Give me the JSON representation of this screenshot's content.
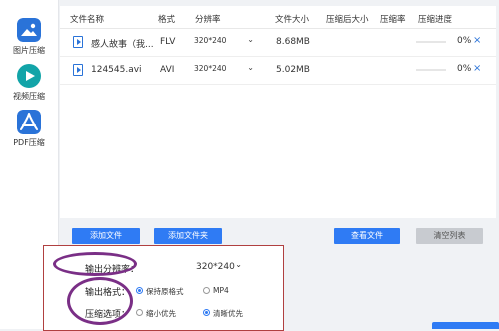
{
  "sidebar": {
    "items": [
      {
        "label": "图片压缩",
        "icon": "image-icon"
      },
      {
        "label": "视频压缩",
        "icon": "play-icon"
      },
      {
        "label": "PDF压缩",
        "icon": "pdf-icon"
      }
    ]
  },
  "table": {
    "headers": [
      "文件名称",
      "格式",
      "分辨率",
      "文件大小",
      "压缩后大小",
      "压缩率",
      "压缩进度"
    ],
    "rows": [
      {
        "name": "感人故事（我...",
        "format": "FLV",
        "resolution": "320*240",
        "size": "8.68MB",
        "compressed_size": "",
        "ratio": "",
        "progress": 0,
        "progress_text": "0%"
      },
      {
        "name": "124545.avi",
        "format": "AVI",
        "resolution": "320*240",
        "size": "5.02MB",
        "compressed_size": "",
        "ratio": "",
        "progress": 0,
        "progress_text": "0%"
      }
    ]
  },
  "buttons": {
    "add_file": "添加文件",
    "add_folder": "添加文件夹",
    "view_file": "查看文件",
    "clear_list": "清空列表"
  },
  "settings": {
    "output_resolution_label": "输出分辨率：",
    "output_resolution_value": "320*240",
    "output_format_label": "输出格式：",
    "format_options": [
      "保持原格式",
      "MP4"
    ],
    "compress_option_label": "压缩选项：",
    "compress_options": [
      "缩小优先",
      "清晰优先"
    ]
  },
  "colors": {
    "accent": "#2f7bf4",
    "annotation": "#7a2f86",
    "panel_border": "#b04040"
  }
}
